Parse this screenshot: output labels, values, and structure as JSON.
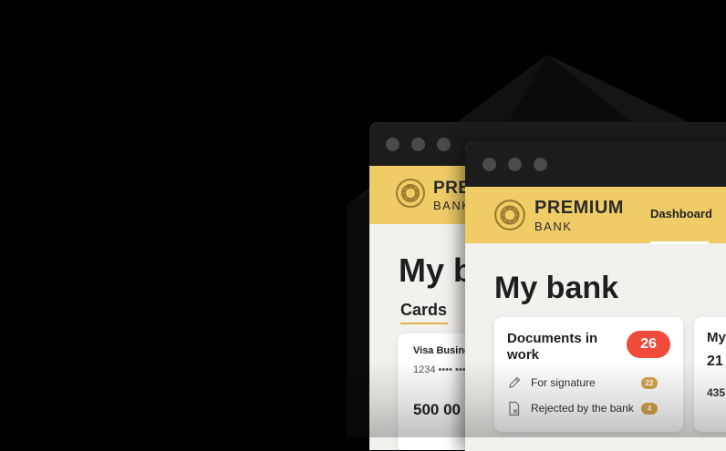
{
  "back_window": {
    "brand_top": "PREMIUM",
    "brand_bottom": "BANK",
    "title": "My b",
    "cards_tab": "Cards",
    "card": {
      "name": "Visa Busine",
      "number": "1234 •••• •••",
      "balance": "500 00"
    }
  },
  "front_window": {
    "brand_top": "PREMIUM",
    "brand_bottom": "BANK",
    "nav_dashboard": "Dashboard",
    "title": "My bank",
    "documents": {
      "title": "Documents in work",
      "badge": "26",
      "rows": [
        {
          "label": "For signature",
          "count": "22",
          "icon": "pen-icon"
        },
        {
          "label": "Rejected by the bank",
          "count": "4",
          "icon": "rejected-document-icon"
        }
      ]
    },
    "side_card": {
      "title": "My",
      "number": "21",
      "sub": "435"
    }
  },
  "colors": {
    "header_yellow": "#f0cc67",
    "titlebar": "#1c1c1c",
    "badge_red": "#f04b3a",
    "count_gold": "#d4a64e",
    "page_bg": "#f2f1ee"
  }
}
